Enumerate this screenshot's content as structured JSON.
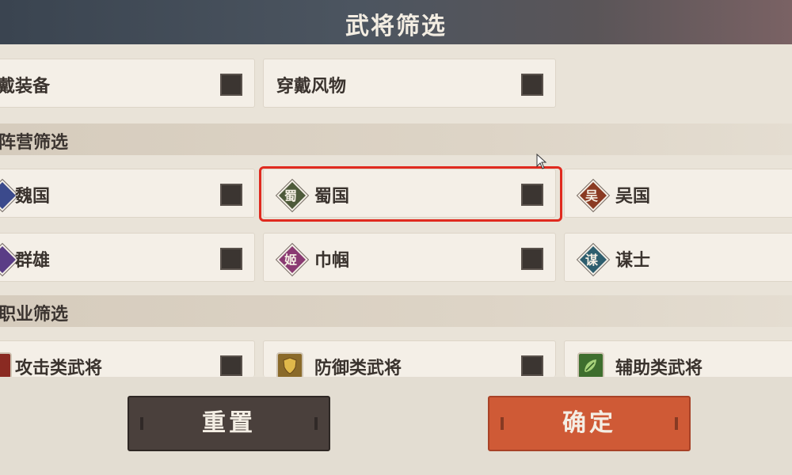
{
  "header": {
    "title": "武将筛选"
  },
  "equip_row": [
    {
      "label": "戴装备",
      "checked": false
    },
    {
      "label": "穿戴风物",
      "checked": false
    }
  ],
  "faction_section": {
    "title": "阵营筛选",
    "items": [
      {
        "label": "魏国",
        "icon": "wei-emblem-icon",
        "glyph": "",
        "color": "#3b4a8c",
        "checked": false
      },
      {
        "label": "蜀国",
        "icon": "shu-emblem-icon",
        "glyph": "蜀",
        "color": "#4e5a3a",
        "checked": false
      },
      {
        "label": "吴国",
        "icon": "wu-emblem-icon",
        "glyph": "吴",
        "color": "#8a3a22",
        "checked": false
      },
      {
        "label": "群雄",
        "icon": "qunxiong-emblem-icon",
        "glyph": "",
        "color": "#5a3d86",
        "checked": false
      },
      {
        "label": "巾帼",
        "icon": "jinguo-emblem-icon",
        "glyph": "姬",
        "color": "#8a3a72",
        "checked": false
      },
      {
        "label": "谋士",
        "icon": "moushi-emblem-icon",
        "glyph": "谋",
        "color": "#2e5e6e",
        "checked": false
      }
    ]
  },
  "class_section": {
    "title": "职业筛选",
    "items": [
      {
        "label": "攻击类武将",
        "icon": "sword-icon",
        "color": "#8a2a22",
        "checked": false
      },
      {
        "label": "防御类武将",
        "icon": "shield-icon",
        "color": "#8a6a2a",
        "checked": false
      },
      {
        "label": "辅助类武将",
        "icon": "leaf-icon",
        "color": "#3e6e2e",
        "checked": false
      }
    ]
  },
  "actions": {
    "reset_label": "重置",
    "confirm_label": "确定"
  }
}
